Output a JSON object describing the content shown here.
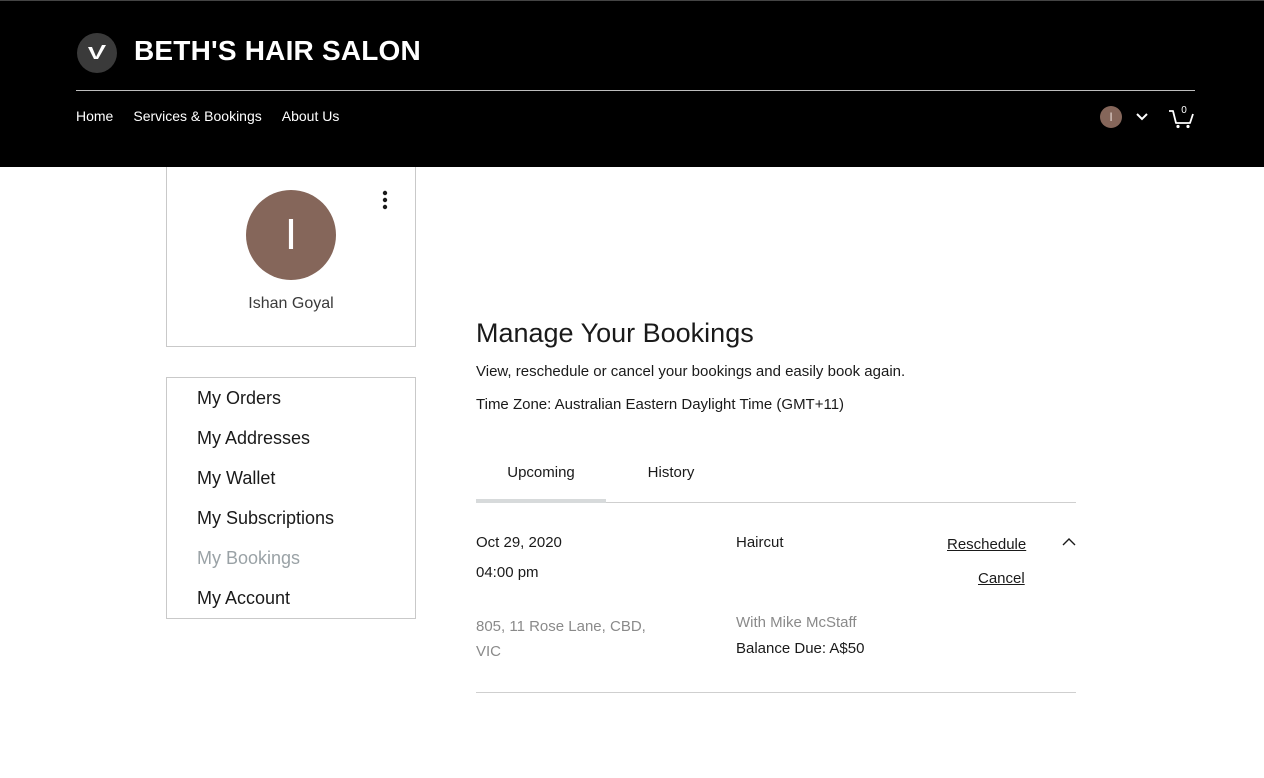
{
  "header": {
    "site_title": "BETH'S HAIR SALON",
    "logo_icon": "wix-v-logo-icon",
    "nav": [
      "Home",
      "Services & Bookings",
      "About Us"
    ],
    "user_initial": "I",
    "cart_count": "0"
  },
  "profile": {
    "initial": "I",
    "name": "Ishan Goyal",
    "avatar_color": "#85665a"
  },
  "side_menu": {
    "items": [
      "My Orders",
      "My Addresses",
      "My Wallet",
      "My Subscriptions",
      "My Bookings",
      "My Account"
    ],
    "active": "My Bookings"
  },
  "main": {
    "title": "Manage Your Bookings",
    "subtitle": "View, reschedule or cancel your bookings and easily book again.",
    "timezone": "Time Zone: Australian Eastern Daylight Time (GMT+11)",
    "tabs": [
      "Upcoming",
      "History"
    ],
    "active_tab": "Upcoming"
  },
  "booking": {
    "date": "Oct 29, 2020",
    "time": "04:00 pm",
    "service": "Haircut",
    "reschedule_label": "Reschedule",
    "cancel_label": "Cancel",
    "address_line1": "805, 11 Rose Lane, CBD,",
    "address_line2": "VIC",
    "staff": "With Mike McStaff",
    "balance": "Balance Due: A$50"
  }
}
